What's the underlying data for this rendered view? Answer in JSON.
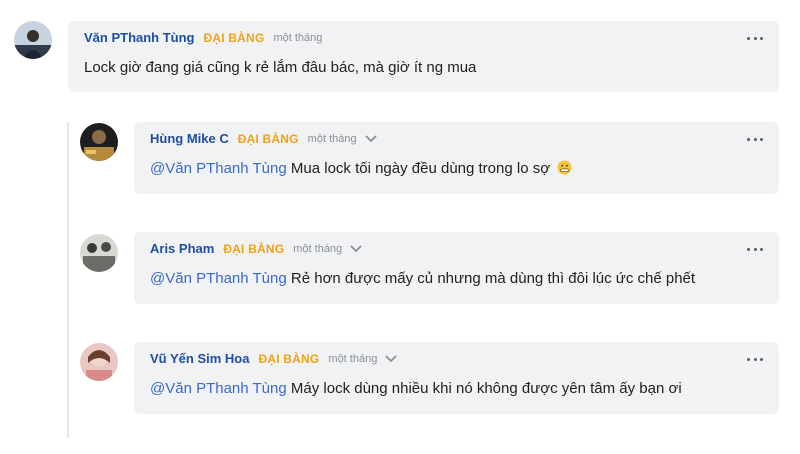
{
  "comments": [
    {
      "author": "Văn PThanh Tùng",
      "badge": "ĐẠI BÀNG",
      "time": "một tháng",
      "mention": "",
      "text": "Lock giờ đang giá cũng k rẻ lắm đâu bác, mà giờ ít ng mua",
      "avatar_icon": "user-avatar-icon"
    },
    {
      "author": "Hùng Mike C",
      "badge": "ĐẠI BÀNG",
      "time": "một tháng",
      "mention": "@Văn PThanh Tùng",
      "text": " Mua lock tối ngày đều dùng trong lo sợ",
      "emoji": "grimacing-emoji-icon",
      "avatar_icon": "user-avatar-icon"
    },
    {
      "author": "Aris Pham",
      "badge": "ĐẠI BÀNG",
      "time": "một tháng",
      "mention": "@Văn PThanh Tùng",
      "text": " Rẻ hơn được mấy củ nhưng mà dùng thì đôi lúc ức chế phết",
      "avatar_icon": "user-avatar-icon"
    },
    {
      "author": "Vũ Yến Sim Hoa",
      "badge": "ĐẠI BÀNG",
      "time": "một tháng",
      "mention": "@Văn PThanh Tùng",
      "text": " Máy lock dùng nhiều khi nó không được yên tâm ấy bạn ơi",
      "avatar_icon": "user-avatar-icon"
    }
  ],
  "colors": {
    "author": "#1d4ea1",
    "badge": "#f0a215",
    "mention": "#3b6ac9",
    "bubble": "#f1f2f4"
  }
}
